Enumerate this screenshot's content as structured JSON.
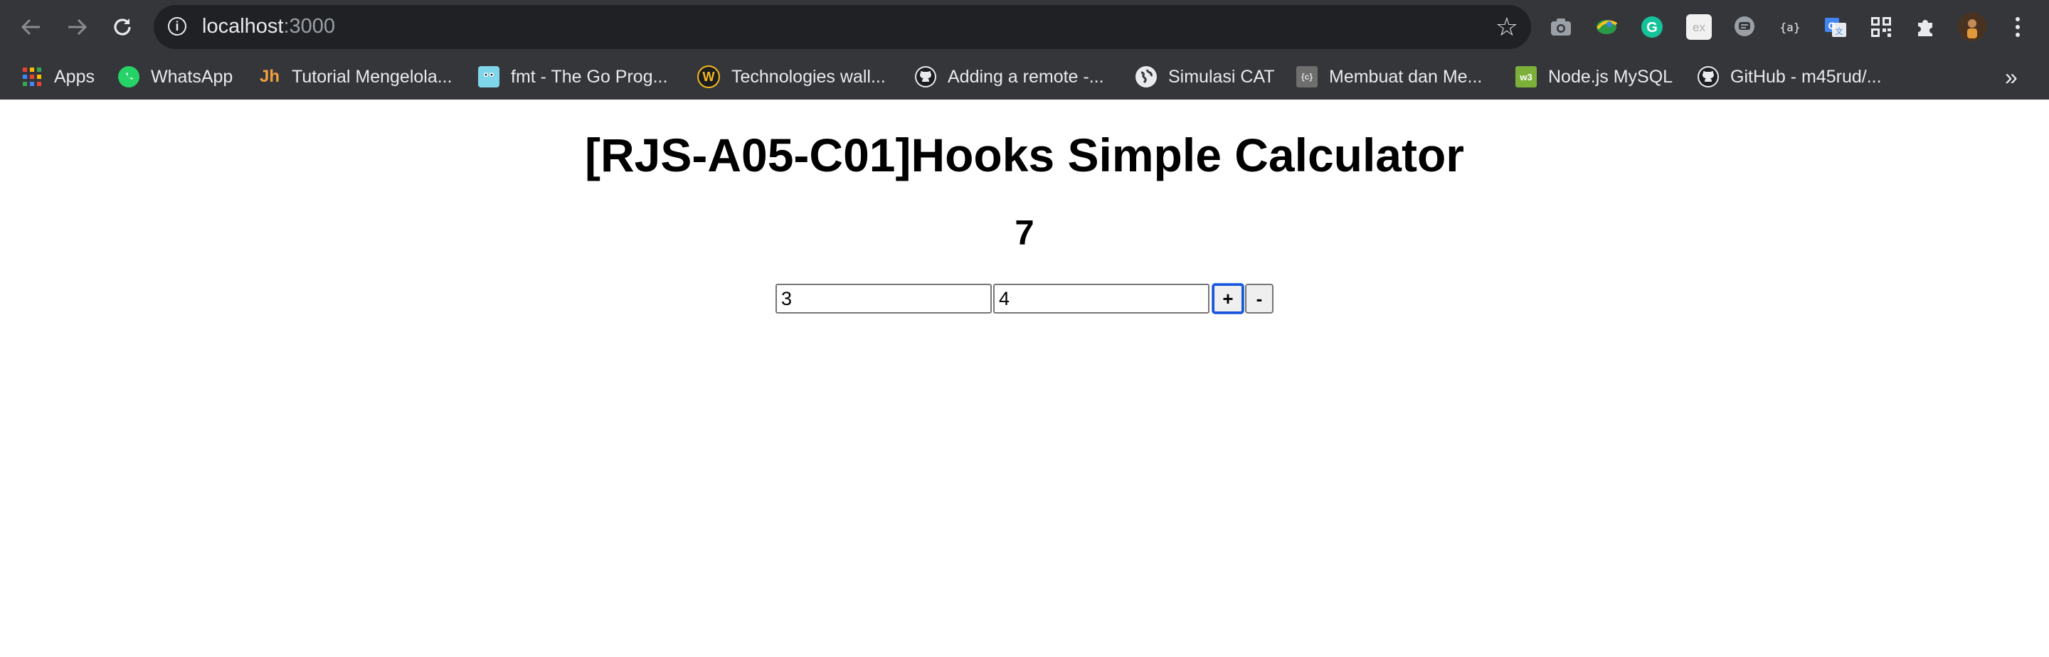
{
  "browser": {
    "url_host": "localhost",
    "url_port": ":3000",
    "bookmarks": [
      {
        "label": "Apps",
        "icon": "apps-grid-icon"
      },
      {
        "label": "WhatsApp",
        "icon": "whatsapp-icon"
      },
      {
        "label": "Tutorial Mengelola...",
        "icon": "jh-logo-icon"
      },
      {
        "label": "fmt - The Go Prog...",
        "icon": "go-gopher-icon"
      },
      {
        "label": "Technologies wall...",
        "icon": "w-shield-icon"
      },
      {
        "label": "Adding a remote -...",
        "icon": "github-icon"
      },
      {
        "label": "Simulasi CAT",
        "icon": "globe-icon"
      },
      {
        "label": "Membuat dan Me...",
        "icon": "codeigniter-icon"
      },
      {
        "label": "Node.js MySQL",
        "icon": "w3schools-icon"
      },
      {
        "label": "GitHub - m45rud/...",
        "icon": "github-icon"
      }
    ],
    "more_bookmarks": "»"
  },
  "page": {
    "title": "[RJS-A05-C01]Hooks Simple Calculator",
    "result": "7",
    "input_a": "3",
    "input_b": "4",
    "plus_label": "+",
    "minus_label": "-"
  }
}
